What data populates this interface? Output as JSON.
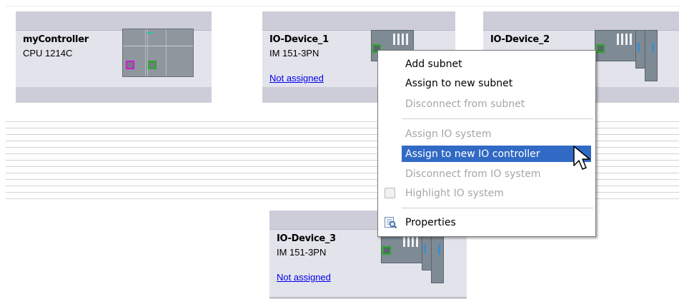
{
  "devices": [
    {
      "id": "controller",
      "name": "myController",
      "type": "CPU 1214C",
      "link": ""
    },
    {
      "id": "io1",
      "name": "IO-Device_1",
      "type": "IM 151-3PN",
      "link": "Not assigned"
    },
    {
      "id": "io2",
      "name": "IO-Device_2",
      "type": "",
      "link": ""
    },
    {
      "id": "io3",
      "name": "IO-Device_3",
      "type": "IM 151-3PN",
      "link": "Not assigned"
    }
  ],
  "context_menu": {
    "items": [
      {
        "label": "Add subnet",
        "enabled": true
      },
      {
        "label": "Assign to new subnet",
        "enabled": true
      },
      {
        "label": "Disconnect from subnet",
        "enabled": false
      },
      {
        "label": "Assign IO system",
        "enabled": false
      },
      {
        "label": "Assign to new IO controller",
        "enabled": true,
        "highlighted": true
      },
      {
        "label": "Disconnect from IO system",
        "enabled": false
      },
      {
        "label": "Highlight IO system",
        "enabled": false,
        "checkbox": true,
        "checked": false
      },
      {
        "label": "Properties",
        "enabled": true,
        "icon": "properties-icon"
      }
    ]
  },
  "colors": {
    "highlight": "#316ac5",
    "link": "#0000ee",
    "disabled_text": "#a6a6a6",
    "port_green": "#2aa82a",
    "port_magenta": "#d018d0"
  },
  "icons": [
    "plc-image",
    "io-device-image",
    "properties-icon",
    "mouse-pointer-icon"
  ]
}
